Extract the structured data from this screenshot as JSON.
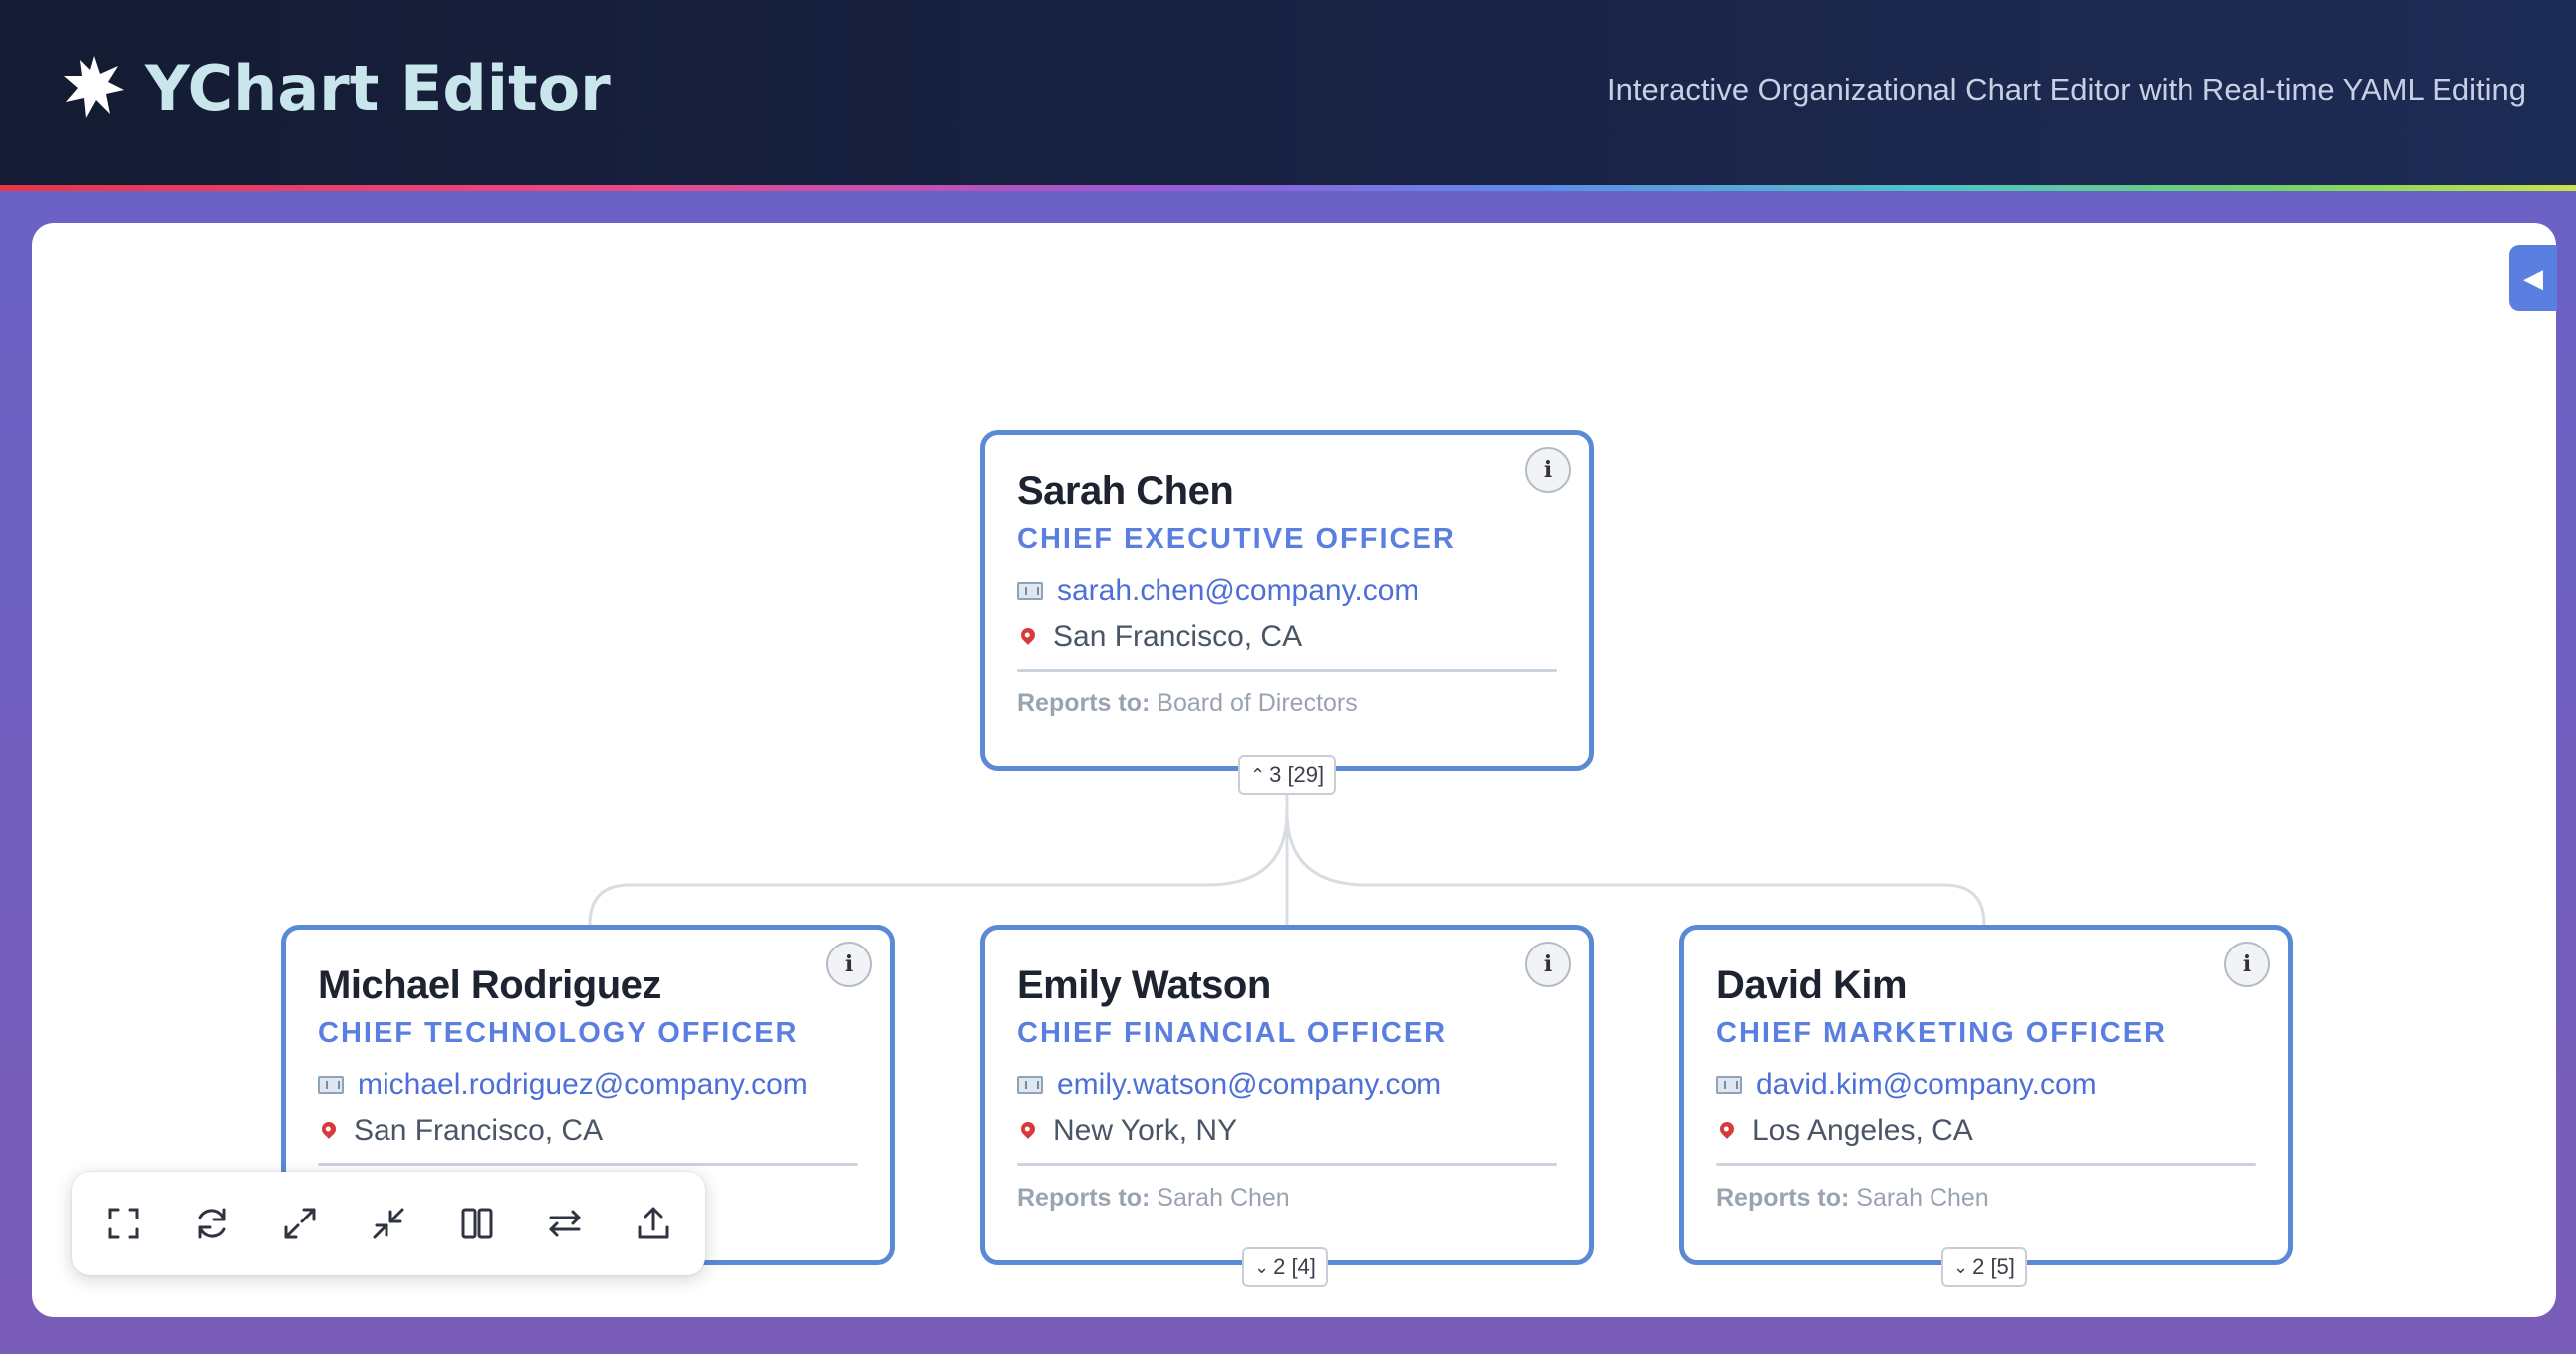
{
  "header": {
    "title": "YChart Editor",
    "subtitle": "Interactive Organizational Chart Editor with Real-time YAML Editing",
    "logo_icon": "star-burst-icon"
  },
  "colors": {
    "accent": "#5a7fe0",
    "card_border": "#5a8ad6",
    "header_bg": "#141b33"
  },
  "sidebar_toggle": {
    "icon": "caret-left-icon"
  },
  "reports_label": "Reports to:",
  "cards": {
    "ceo": {
      "name": "Sarah Chen",
      "title": "CHIEF EXECUTIVE OFFICER",
      "email": "sarah.chen@company.com",
      "location": "San Francisco, CA",
      "reports_to": "Board of Directors",
      "children_badge": "3 [29]",
      "badge_state": "expanded"
    },
    "cto": {
      "name": "Michael Rodriguez",
      "title": "CHIEF TECHNOLOGY OFFICER",
      "email": "michael.rodriguez@company.com",
      "location": "San Francisco, CA"
    },
    "cfo": {
      "name": "Emily Watson",
      "title": "CHIEF FINANCIAL OFFICER",
      "email": "emily.watson@company.com",
      "location": "New York, NY",
      "reports_to": "Sarah Chen",
      "children_badge": "2 [4]",
      "badge_state": "collapsed"
    },
    "cmo": {
      "name": "David Kim",
      "title": "CHIEF MARKETING OFFICER",
      "email": "david.kim@company.com",
      "location": "Los Angeles, CA",
      "reports_to": "Sarah Chen",
      "children_badge": "2 [5]",
      "badge_state": "collapsed"
    }
  },
  "toolbar": {
    "tools": [
      "fit-screen-icon",
      "refresh-icon",
      "expand-all-icon",
      "collapse-all-icon",
      "columns-icon",
      "swap-icon",
      "export-icon"
    ]
  }
}
